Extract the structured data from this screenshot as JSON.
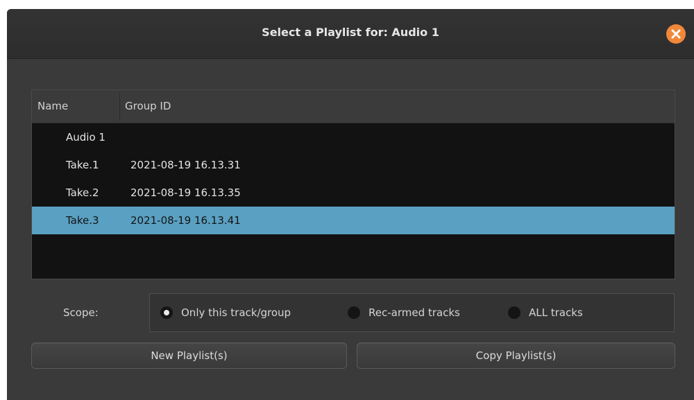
{
  "dialog": {
    "title": "Select a Playlist for: Audio 1",
    "close_icon": "close-icon"
  },
  "list": {
    "columns": [
      "Name",
      "Group ID"
    ],
    "rows": [
      {
        "name": "Audio 1",
        "group_id": ""
      },
      {
        "name": "Take.1",
        "group_id": "2021-08-19 16.13.31"
      },
      {
        "name": "Take.2",
        "group_id": "2021-08-19 16.13.35"
      },
      {
        "name": "Take.3",
        "group_id": "2021-08-19 16.13.41",
        "selected": true
      }
    ],
    "selection_color": "#5aa0c2"
  },
  "scope": {
    "label": "Scope:",
    "options": [
      {
        "label": "Only this track/group",
        "checked": true
      },
      {
        "label": "Rec-armed tracks",
        "checked": false
      },
      {
        "label": "ALL tracks",
        "checked": false
      }
    ]
  },
  "buttons": {
    "new_playlist": "New Playlist(s)",
    "copy_playlist": "Copy Playlist(s)"
  },
  "colors": {
    "close_button": "#f0883a",
    "background": "#3a3a3a"
  }
}
